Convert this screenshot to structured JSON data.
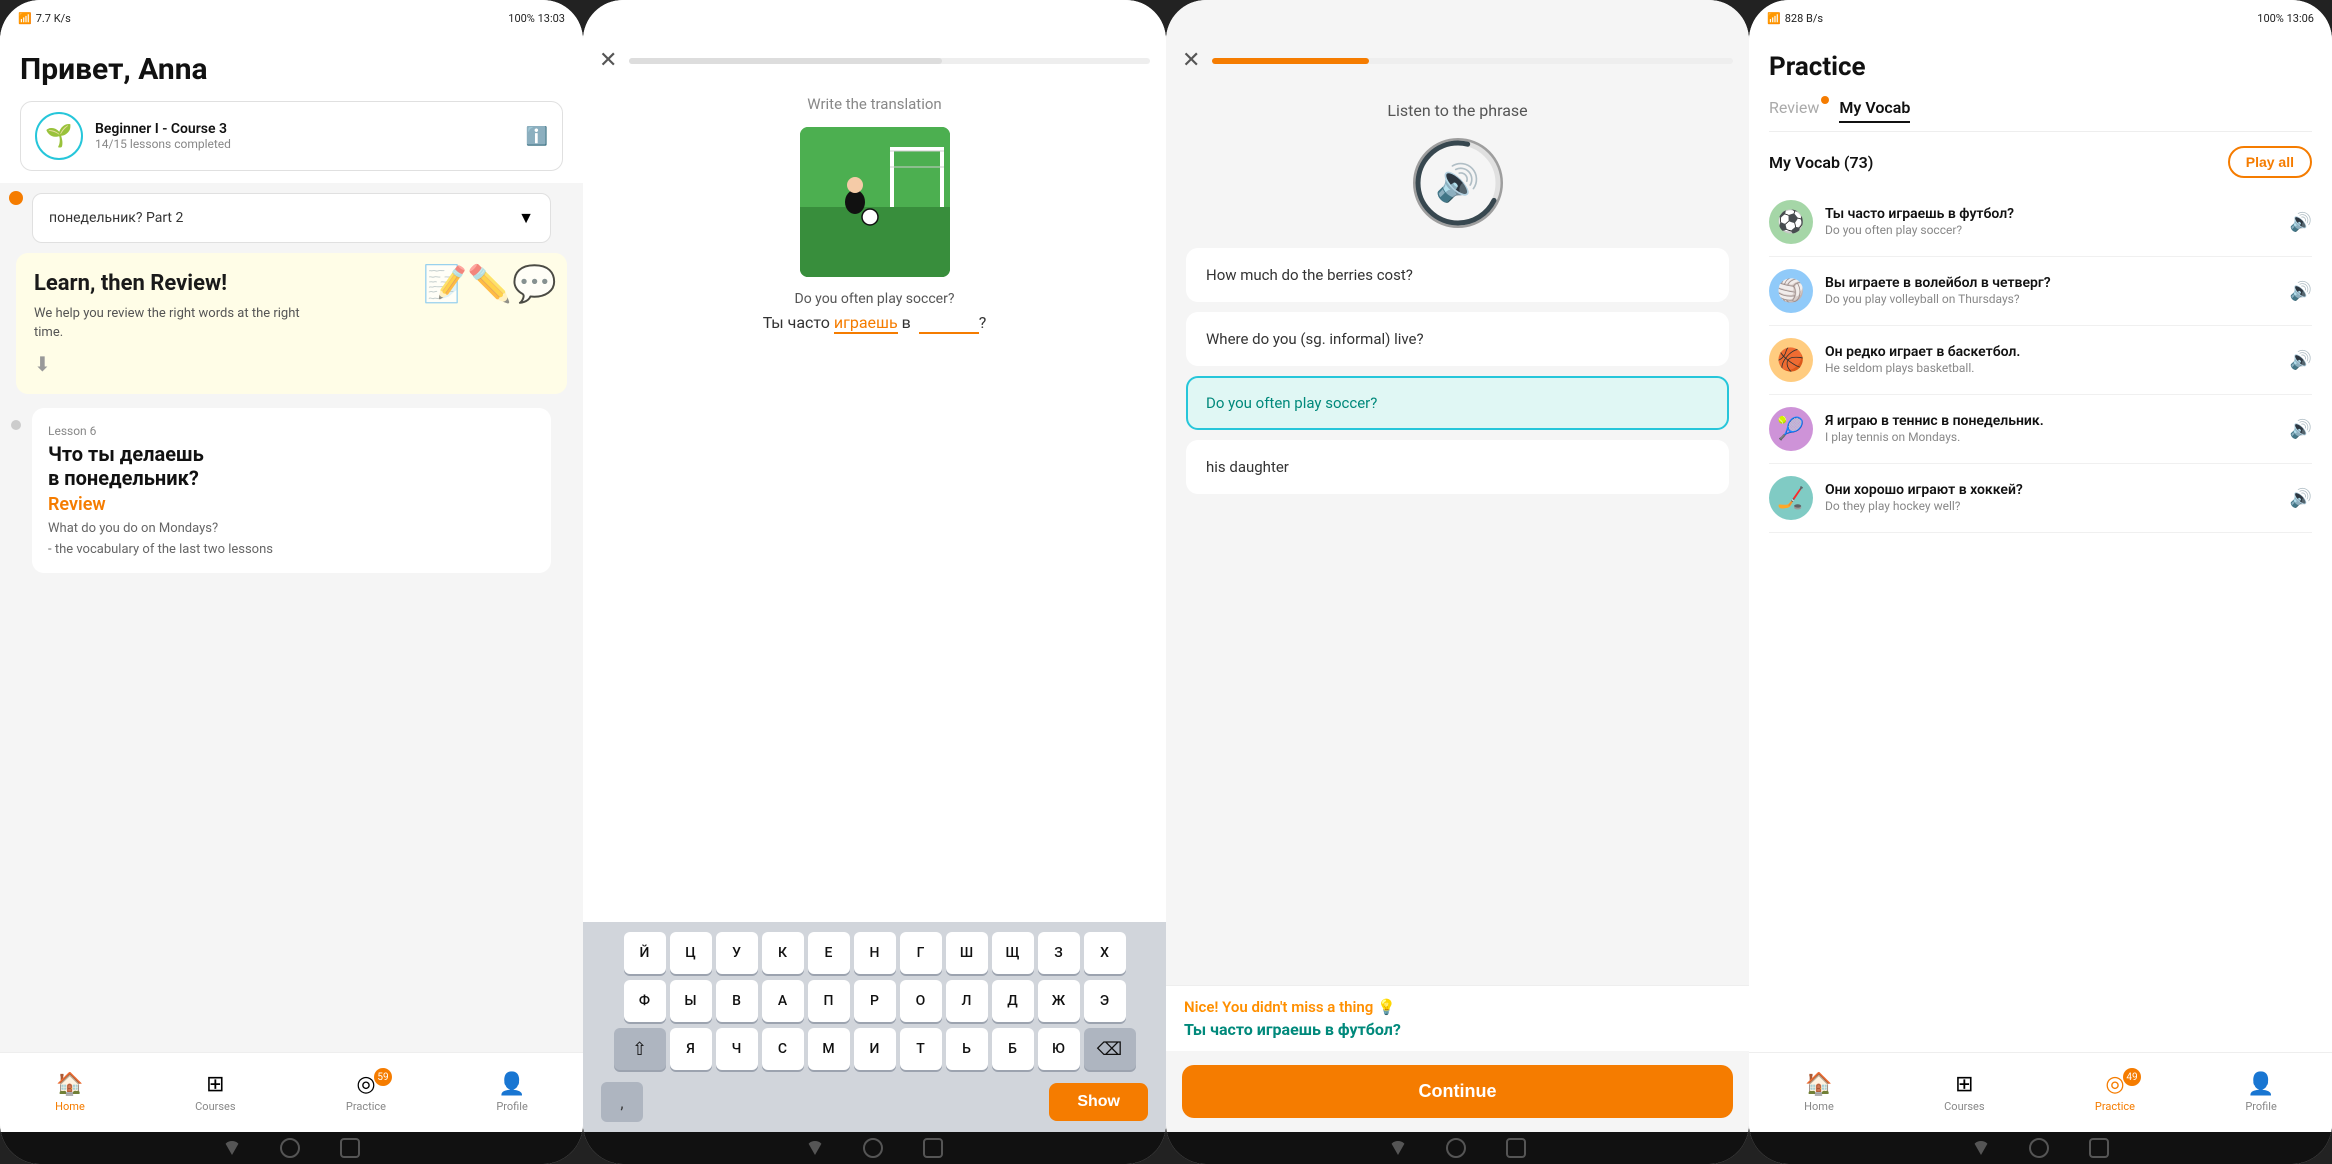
{
  "screen1": {
    "status_left": "7.7 K/s",
    "status_right": "100% 13:03",
    "greeting": "Привет, Anna",
    "course_name": "Beginner I - Course 3",
    "course_progress": "14/15 lessons completed",
    "lesson_dropdown": "понедельник? Part 2",
    "review_title": "Learn, then Review!",
    "review_text": "We help you review the right words at the right time.",
    "lesson_number": "Lesson 6",
    "lesson_title": "Что ты делаешь",
    "lesson_title2": "в понедельник?",
    "lesson_subtitle": "Review",
    "lesson_desc": "What do you do on Mondays?",
    "lesson_desc2": "- the vocabulary of the last two lessons",
    "nav": {
      "home": "Home",
      "courses": "Courses",
      "practice": "Practice",
      "profile": "Profile",
      "practice_badge": "59"
    }
  },
  "screen2": {
    "instruction": "Write the translation",
    "sentence": "Do you often play soccer?",
    "fill_text_pre": "Ты часто ",
    "fill_word": "играешь",
    "fill_text_post": " в",
    "fill_blank": "_______",
    "fill_end": "?",
    "keyboard_rows": [
      [
        "Й",
        "Ц",
        "У",
        "К",
        "Е",
        "Н",
        "Г",
        "Ш",
        "Щ",
        "З",
        "Х"
      ],
      [
        "Ф",
        "Ы",
        "В",
        "А",
        "П",
        "Р",
        "О",
        "Л",
        "Д",
        "Ж",
        "Э"
      ],
      [
        "⇧",
        "Я",
        "Ч",
        "С",
        "М",
        "И",
        "Т",
        "Ь",
        "Б",
        "Ю",
        "⌫"
      ]
    ],
    "show_btn": "Show"
  },
  "screen3": {
    "instruction": "Listen to the phrase",
    "choices": [
      "How much do the berries cost?",
      "Where do you (sg. informal) live?",
      "Do you often play soccer?",
      "his daughter"
    ],
    "selected_choice": "Do you often play soccer?",
    "result_text": "Nice! You didn't miss a thing 💡",
    "result_answer": "Ты часто играешь в футбол?",
    "continue_btn": "Continue"
  },
  "screen4": {
    "status_left": "828 B/s",
    "status_right": "100% 13:06",
    "title": "Practice",
    "tab_review": "Review",
    "tab_myvocab": "My Vocab",
    "vocab_title": "My Vocab  (73)",
    "play_all": "Play all",
    "vocab_items": [
      {
        "russian": "Ты часто играешь в футбол?",
        "english": "Do you often play soccer?",
        "color": "av1",
        "emoji": "⚽"
      },
      {
        "russian": "Вы играете в волейбол в четверг?",
        "english": "Do you play volleyball on Thursdays?",
        "color": "av2",
        "emoji": "🏐"
      },
      {
        "russian": "Он редко играет в баскетбол.",
        "english": "He seldom plays basketball.",
        "color": "av3",
        "emoji": "🏀"
      },
      {
        "russian": "Я играю в теннис в понедельник.",
        "english": "I play tennis on Mondays.",
        "color": "av4",
        "emoji": "🎾"
      },
      {
        "russian": "Они хорошо играют в хоккей?",
        "english": "Do they play hockey well?",
        "color": "av5",
        "emoji": "🏒"
      }
    ],
    "nav": {
      "home": "Home",
      "courses": "Courses",
      "practice": "Practice",
      "profile": "Profile",
      "practice_badge": "49"
    }
  }
}
